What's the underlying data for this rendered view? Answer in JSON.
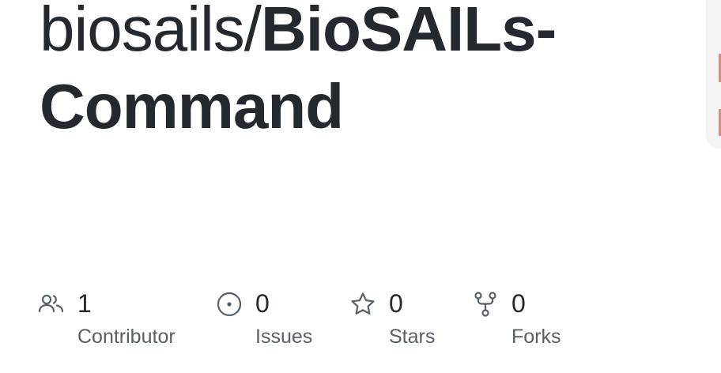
{
  "repo": {
    "owner": "biosails/",
    "name": "BioSAILs-Command"
  },
  "stats": {
    "contributors": {
      "count": "1",
      "label": "Contributor",
      "icon": "people-icon"
    },
    "issues": {
      "count": "0",
      "label": "Issues",
      "icon": "issue-circle-icon"
    },
    "stars": {
      "count": "0",
      "label": "Stars",
      "icon": "star-icon"
    },
    "forks": {
      "count": "0",
      "label": "Forks",
      "icon": "fork-icon"
    }
  },
  "colors": {
    "text": "#24292f",
    "muted": "#57606a",
    "icon": "#57606a",
    "accent": "#d98f6a"
  }
}
